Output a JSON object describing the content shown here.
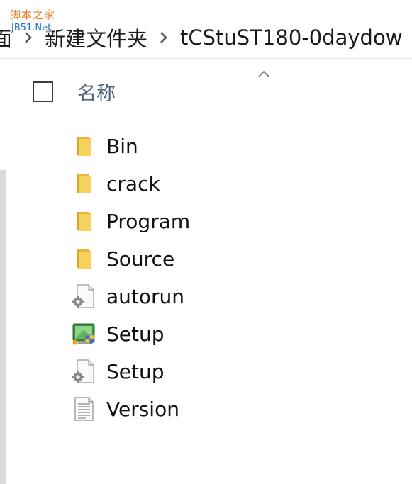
{
  "watermark": {
    "line1": "脚本之家",
    "line2": "JB51.Net"
  },
  "breadcrumb": {
    "items": [
      {
        "label": "面"
      },
      {
        "label": "新建文件夹"
      },
      {
        "label": "tCStuST180-0daydow"
      }
    ]
  },
  "list": {
    "header": {
      "name_label": "名称",
      "sort_icon": "chevron-up-icon"
    },
    "items": [
      {
        "name": "Bin",
        "icon": "folder-icon"
      },
      {
        "name": "crack",
        "icon": "folder-icon"
      },
      {
        "name": "Program",
        "icon": "folder-icon"
      },
      {
        "name": "Source",
        "icon": "folder-icon"
      },
      {
        "name": "autorun",
        "icon": "settings-file-icon"
      },
      {
        "name": "Setup",
        "icon": "installer-icon"
      },
      {
        "name": "Setup",
        "icon": "settings-file-icon"
      },
      {
        "name": "Version",
        "icon": "text-file-icon"
      }
    ]
  },
  "colors": {
    "folder": "#f5c842",
    "header_text": "#4c607a",
    "watermark": "#f07818"
  }
}
